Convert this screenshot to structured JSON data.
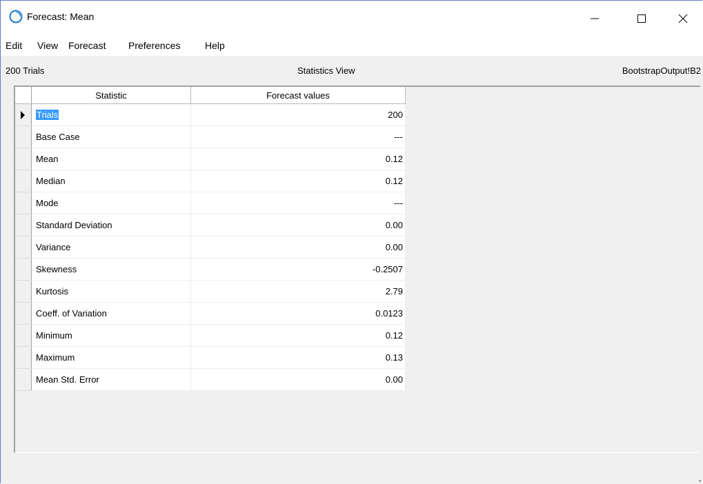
{
  "window": {
    "title": "Forecast: Mean",
    "controls": [
      "minimize-icon",
      "maximize-icon",
      "close-icon"
    ]
  },
  "menu": {
    "items": [
      {
        "label": "Edit"
      },
      {
        "label": "View"
      },
      {
        "label": "Forecast"
      },
      {
        "label": "Preferences"
      },
      {
        "label": "Help"
      }
    ]
  },
  "status": {
    "trials": "200 Trials",
    "view": "Statistics View",
    "cell": "BootstrapOutput!B2"
  },
  "table": {
    "headers": [
      "Statistic",
      "Forecast values"
    ],
    "rows": [
      {
        "stat": "Trials",
        "value": "200"
      },
      {
        "stat": "Base Case",
        "value": "---"
      },
      {
        "stat": "Mean",
        "value": "0.12"
      },
      {
        "stat": "Median",
        "value": "0.12"
      },
      {
        "stat": "Mode",
        "value": "---"
      },
      {
        "stat": "Standard Deviation",
        "value": "0.00"
      },
      {
        "stat": "Variance",
        "value": "0.00"
      },
      {
        "stat": "Skewness",
        "value": "-0.2507"
      },
      {
        "stat": "Kurtosis",
        "value": "2.79"
      },
      {
        "stat": "Coeff. of Variation",
        "value": "0.0123"
      },
      {
        "stat": "Minimum",
        "value": "0.12"
      },
      {
        "stat": "Maximum",
        "value": "0.13"
      },
      {
        "stat": "Mean Std. Error",
        "value": "0.00"
      }
    ]
  },
  "colors": {
    "selection": "#3399ff",
    "icon_blue": "#1c79c9"
  }
}
